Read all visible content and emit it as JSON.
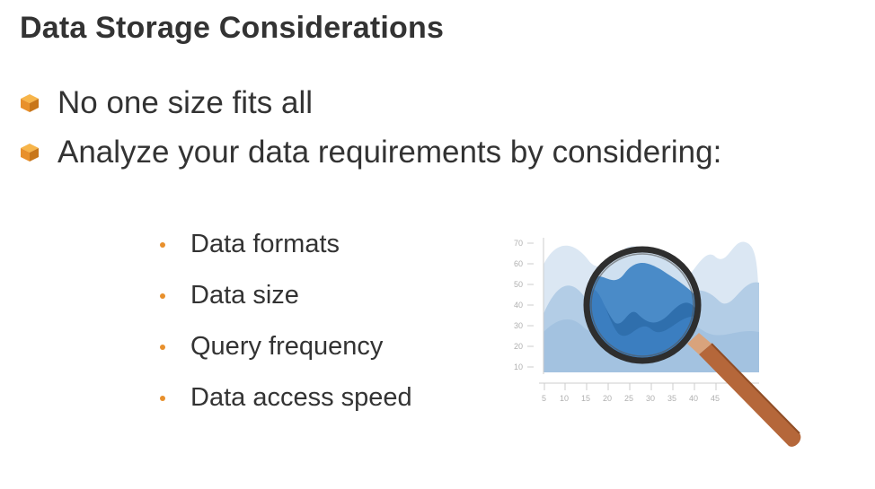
{
  "slide": {
    "title": "Data Storage Considerations",
    "main_bullets": [
      {
        "text": "No one size fits all",
        "icon": "cube-icon"
      },
      {
        "text": "Analyze your data requirements by considering:",
        "icon": "cube-icon"
      }
    ],
    "sub_bullets": [
      "Data formats",
      "Data size",
      "Query frequency",
      "Data access speed"
    ]
  },
  "illustration": {
    "y_ticks": [
      "70",
      "60",
      "50",
      "40",
      "30",
      "20",
      "10"
    ],
    "x_ticks": [
      "5",
      "10",
      "15",
      "20",
      "25",
      "30",
      "35",
      "40",
      "45"
    ],
    "icon": "magnifying-glass-icon"
  },
  "colors": {
    "bullet_accent": "#e8902c",
    "cube_light": "#f5a623",
    "cube_dark": "#c8761a",
    "chart_light": "#d9e6f2",
    "chart_mid": "#a9c6e2",
    "chart_dark": "#3d7ab8",
    "handle": "#b5673a"
  }
}
